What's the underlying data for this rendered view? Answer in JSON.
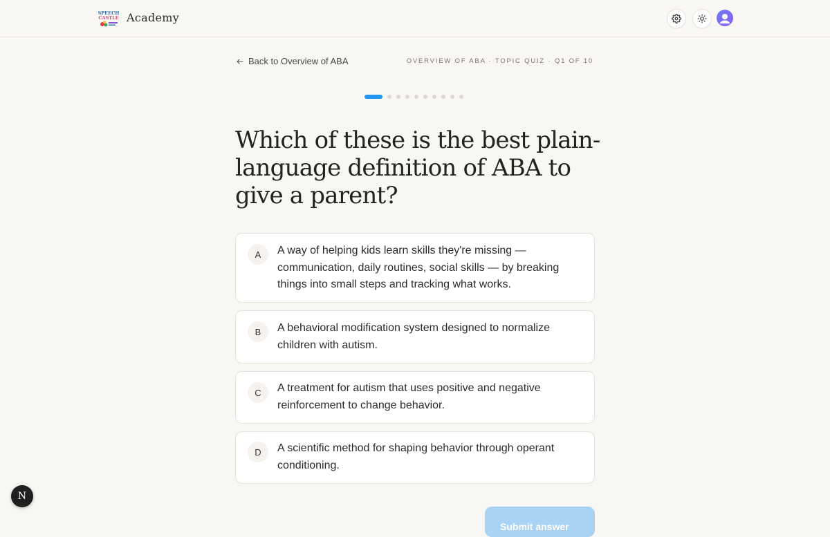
{
  "header": {
    "brand": "Academy",
    "logo_text": "SPEECH CASTLE"
  },
  "nav": {
    "back_label": "Back to Overview of ABA",
    "breadcrumb": "OVERVIEW OF ABA · TOPIC QUIZ · Q1 OF 10"
  },
  "progress": {
    "current": 1,
    "total": 10
  },
  "question": {
    "text": "Which of these is the best plain-language definition of ABA to give a parent?"
  },
  "options": [
    {
      "letter": "A",
      "text": "A way of helping kids learn skills they're missing — communication, daily routines, social skills — by breaking things into small steps and tracking what works."
    },
    {
      "letter": "B",
      "text": "A behavioral modification system designed to normalize children with autism."
    },
    {
      "letter": "C",
      "text": "A treatment for autism that uses positive and negative reinforcement to change behavior."
    },
    {
      "letter": "D",
      "text": "A scientific method for shaping behavior through operant conditioning."
    }
  ],
  "submit": {
    "label": "Submit answer"
  },
  "dev_badge": {
    "label": "N"
  },
  "colors": {
    "accent": "#2196f3",
    "submit_disabled": "#a9d3f5",
    "background": "#f9f7f3"
  }
}
